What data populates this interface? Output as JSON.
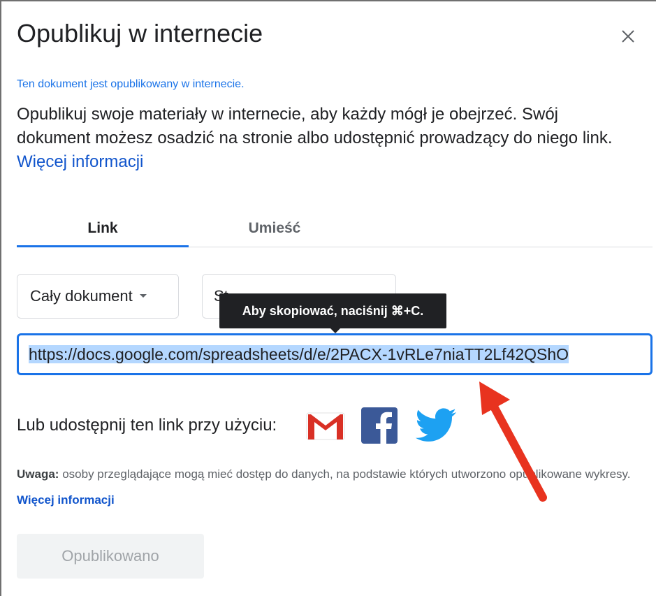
{
  "dialog": {
    "title": "Opublikuj w internecie",
    "status": "Ten dokument jest opublikowany w internecie.",
    "description": "Opublikuj swoje materiały w internecie, aby każdy mógł je obejrzeć. Swój dokument możesz osadzić na stronie albo udostępnić prowadzący do niego link.",
    "more_info_link": "Więcej informacji"
  },
  "tabs": [
    {
      "label": "Link",
      "active": true
    },
    {
      "label": "Umieść",
      "active": false
    }
  ],
  "selectors": {
    "scope": "Cały dokument",
    "format_partial": "St"
  },
  "tooltip": "Aby skopiować, naciśnij ⌘+C.",
  "url_field": {
    "value": "https://docs.google.com/spreadsheets/d/e/2PACX-1vRLe7niaTT2Lf42QShO"
  },
  "share": {
    "label": "Lub udostępnij ten link przy użyciu:",
    "icons": [
      "gmail-icon",
      "facebook-icon",
      "twitter-icon"
    ]
  },
  "note": {
    "bold_label": "Uwaga:",
    "text": "osoby przeglądające mogą mieć dostęp do danych, na podstawie których utworzono opublikowane wykresy.",
    "link": "Więcej informacji"
  },
  "published_button": "Opublikowano",
  "colors": {
    "accent": "#1a73e8",
    "link": "#1155cc",
    "tooltip_bg": "#202124",
    "annotation_arrow": "#e8331f",
    "gmail": "#d93025",
    "facebook": "#3b5998",
    "twitter": "#1da1f2"
  }
}
